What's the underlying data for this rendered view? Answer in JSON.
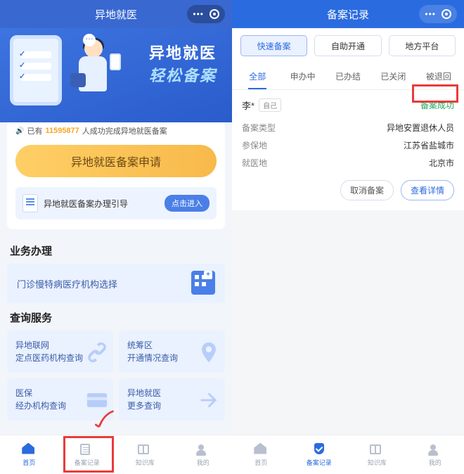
{
  "left": {
    "title": "异地就医",
    "hero": {
      "line1": "异地就医",
      "line2": "轻松备案"
    },
    "stat": {
      "pre": "已有",
      "count": "11595877",
      "post": "人成功完成异地就医备案"
    },
    "apply_btn": "异地就医备案申请",
    "guide": {
      "text": "异地就医备案办理引导",
      "btn": "点击进入"
    },
    "biz_title": "业务办理",
    "biz_item": "门诊慢特病医疗机构选择",
    "query_title": "查询服务",
    "queries": [
      {
        "l1": "异地联网",
        "l2": "定点医药机构查询"
      },
      {
        "l1": "统筹区",
        "l2": "开通情况查询"
      },
      {
        "l1": "医保",
        "l2": "经办机构查询"
      },
      {
        "l1": "异地就医",
        "l2": "更多查询"
      }
    ],
    "tabs": [
      "首页",
      "备案记录",
      "知识库",
      "我的"
    ]
  },
  "right": {
    "title": "备案记录",
    "pills": [
      "快速备案",
      "自助开通",
      "地方平台"
    ],
    "segs": [
      "全部",
      "申办中",
      "已办结",
      "已关闭",
      "被退回"
    ],
    "record": {
      "name": "李*",
      "rel": "自己",
      "status": "备案成功",
      "rows": [
        {
          "k": "备案类型",
          "v": "异地安置退休人员"
        },
        {
          "k": "参保地",
          "v": "江苏省盐城市"
        },
        {
          "k": "就医地",
          "v": "北京市"
        }
      ],
      "cancel": "取消备案",
      "detail": "查看详情"
    },
    "tabs": [
      "首页",
      "备案记录",
      "知识库",
      "我的"
    ]
  }
}
